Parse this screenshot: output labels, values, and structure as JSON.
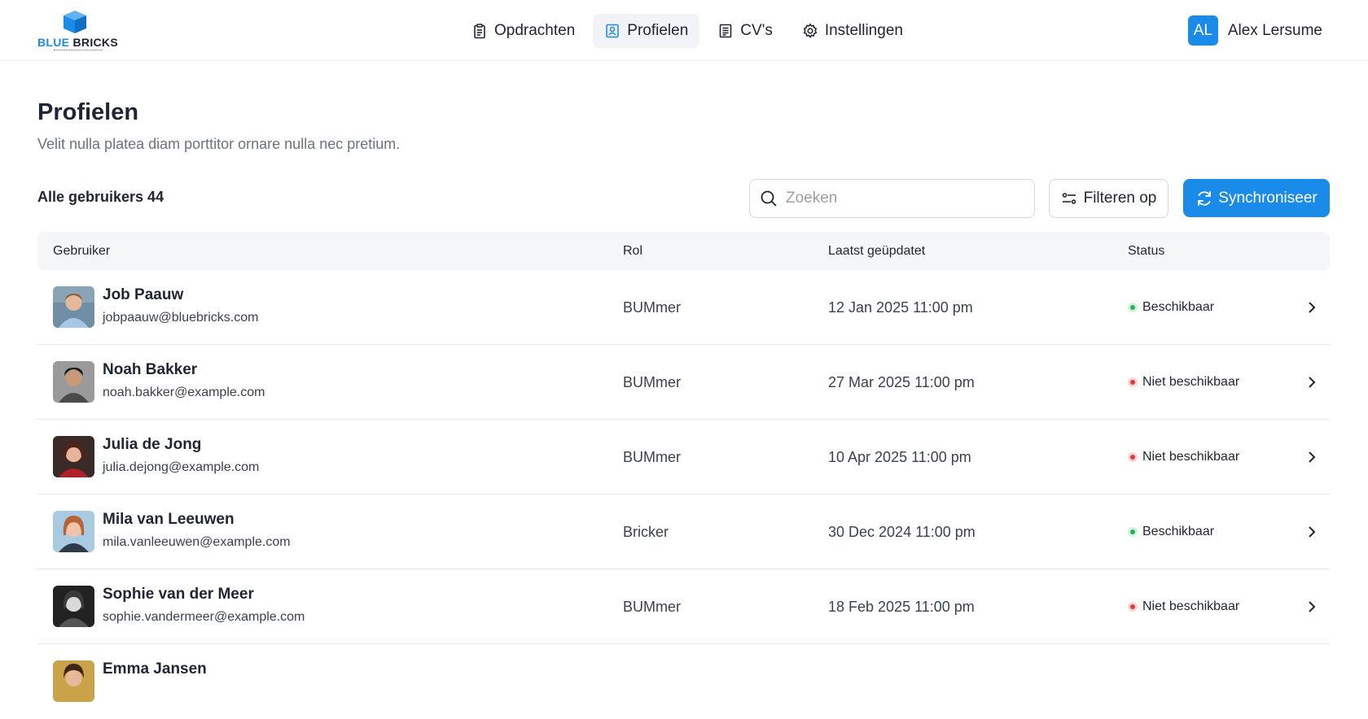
{
  "brand": {
    "logo_text_blue": "BLUE",
    "logo_text_dark": "BRICKS"
  },
  "nav": {
    "items": [
      {
        "label": "Opdrachten",
        "icon": "clipboard-icon"
      },
      {
        "label": "Profielen",
        "icon": "profile-card-icon",
        "active": true
      },
      {
        "label": "CV's",
        "icon": "document-icon"
      },
      {
        "label": "Instellingen",
        "icon": "gear-icon"
      }
    ]
  },
  "user": {
    "initials": "AL",
    "name": "Alex Lersume"
  },
  "page": {
    "title": "Profielen",
    "subtitle": "Velit nulla platea diam porttitor ornare nulla nec pretium."
  },
  "toolbar": {
    "count_label": "Alle gebruikers 44",
    "search_placeholder": "Zoeken",
    "filter_label": "Filteren op",
    "sync_label": "Synchroniseer"
  },
  "table": {
    "headers": {
      "user": "Gebruiker",
      "role": "Rol",
      "updated": "Laatst geüpdatet",
      "status": "Status"
    },
    "rows": [
      {
        "name": "Job Paauw",
        "email": "jobpaauw@bluebricks.com",
        "role": "BUMmer",
        "updated": "12 Jan 2025 11:00 pm",
        "status": "Beschikbaar",
        "available": true
      },
      {
        "name": "Noah Bakker",
        "email": "noah.bakker@example.com",
        "role": "BUMmer",
        "updated": "27 Mar 2025 11:00 pm",
        "status": "Niet beschikbaar",
        "available": false
      },
      {
        "name": "Julia de Jong",
        "email": "julia.dejong@example.com",
        "role": "BUMmer",
        "updated": "10 Apr 2025 11:00 pm",
        "status": "Niet beschikbaar",
        "available": false
      },
      {
        "name": "Mila van Leeuwen",
        "email": "mila.vanleeuwen@example.com",
        "role": "Bricker",
        "updated": "30 Dec 2024 11:00 pm",
        "status": "Beschikbaar",
        "available": true
      },
      {
        "name": "Sophie van der Meer",
        "email": "sophie.vandermeer@example.com",
        "role": "BUMmer",
        "updated": "18 Feb 2025 11:00 pm",
        "status": "Niet beschikbaar",
        "available": false
      },
      {
        "name": "Emma Jansen",
        "email": "",
        "role": "",
        "updated": "",
        "status": "",
        "available": null
      }
    ]
  },
  "colors": {
    "accent": "#1b8bea",
    "available": "#22b45a",
    "unavailable": "#e5383b"
  }
}
